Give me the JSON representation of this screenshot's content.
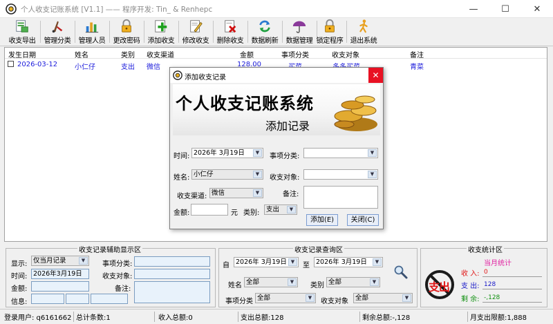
{
  "window": {
    "title": "个人收支记账系统 [V1.1] —— 程序开发: Tin_ & Renhepc",
    "min": "—",
    "max": "☐",
    "close": "✕"
  },
  "toolbar": [
    {
      "label": "收支导出",
      "icon": "export-icon"
    },
    {
      "label": "管理分类",
      "icon": "category-icon"
    },
    {
      "label": "管理人员",
      "icon": "people-chart-icon"
    },
    {
      "label": "更改密码",
      "icon": "lock-icon"
    },
    {
      "label": "添加收支",
      "icon": "add-icon"
    },
    {
      "label": "修改收支",
      "icon": "edit-icon"
    },
    {
      "label": "删除收支",
      "icon": "delete-icon"
    },
    {
      "label": "数据刷新",
      "icon": "refresh-icon"
    },
    {
      "label": "数据管理",
      "icon": "umbrella-icon"
    },
    {
      "label": "锁定程序",
      "icon": "lock-program-icon"
    },
    {
      "label": "退出系统",
      "icon": "exit-icon"
    }
  ],
  "table": {
    "headers": [
      "发生日期",
      "姓名",
      "类别",
      "收支渠道",
      "金额",
      "事项分类",
      "收支对象",
      "备注"
    ],
    "rows": [
      [
        "2026-03-12",
        "小仁仔",
        "支出",
        "微信",
        "128.00",
        "买菜",
        "多多买菜",
        "青菜"
      ]
    ]
  },
  "assist": {
    "title": "收支记录辅助显示区",
    "show_label": "显示:",
    "show_value": "仅当月记录",
    "category_label": "事项分类:",
    "time_label": "时间:",
    "time_value": "2026年3月19日",
    "object_label": "收支对象:",
    "amount_label": "金额:",
    "note_label": "备注:",
    "info_label": "信息:"
  },
  "query": {
    "title": "收支记录查询区",
    "from_label": "自",
    "from_value": "2026年 3月19日",
    "to_label": "至",
    "to_value": "2026年 3月19日",
    "name_label": "姓名",
    "name_value": "全部",
    "type_label": "类别",
    "type_value": "全部",
    "category_label": "事项分类",
    "category_value": "全部",
    "object_label": "收支对象",
    "object_value": "全部"
  },
  "stats": {
    "title": "收支统计区",
    "month_label": "当月统计",
    "income_label": "收 入:",
    "income_value": "0",
    "expense_label": "支 出:",
    "expense_value": "128",
    "balance_label": "剩 余:",
    "balance_value": "-,128",
    "stamp_text": "支出",
    "colors": {
      "income": "#e01818",
      "expense": "#1818c8",
      "balance": "#109010",
      "month": "#e020a0"
    }
  },
  "status": {
    "user": "登录用户: q6161662",
    "count": "总计条数:1",
    "income_total": "收入总额:0",
    "expense_total": "支出总额:128",
    "balance_total": "剩余总额:-,128",
    "month_limit": "月支出限额:1,888"
  },
  "dialog": {
    "title": "添加收支记录",
    "banner_title": "个人收支记账系统",
    "banner_sub": "添加记录",
    "time_label": "时间:",
    "time_value": "2026年 3月19日",
    "category_label": "事项分类:",
    "name_label": "姓名:",
    "name_value": "小仁仔",
    "object_label": "收支对象:",
    "channel_label": "收支渠道:",
    "channel_value": "微信",
    "note_label": "备注:",
    "amount_label": "金额:",
    "amount_unit": "元",
    "type_label": "类别:",
    "type_value": "支出",
    "add_button": "添加(E)",
    "close_button": "关闭(C)"
  }
}
